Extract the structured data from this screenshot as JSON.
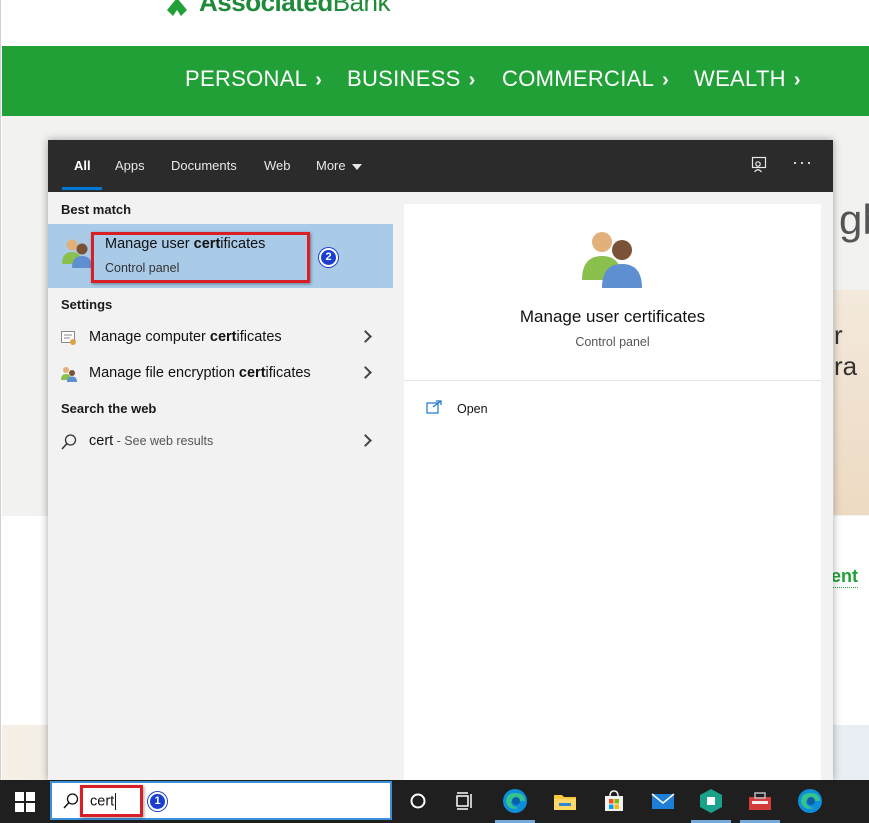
{
  "website": {
    "logo_text_bold": "Associated",
    "logo_text_light": "Bank",
    "nav": [
      "PERSONAL",
      "BUSINESS",
      "COMMERCIAL",
      "WEALTH"
    ],
    "nav_chevron": "›",
    "peek_text_1": "gh",
    "peek_text_2": "r ra",
    "peek_link": "ent",
    "brand_green": "#21a038"
  },
  "search_panel": {
    "tabs": [
      "All",
      "Apps",
      "Documents",
      "Web",
      "More"
    ],
    "active_tab": "All",
    "ellipsis": "···",
    "best_match_header": "Best match",
    "best_match": {
      "title_prefix": "Manage user ",
      "title_bold": "cert",
      "title_suffix": "ificates",
      "subtitle": "Control panel"
    },
    "settings_header": "Settings",
    "settings": [
      {
        "prefix": "Manage computer ",
        "bold": "cert",
        "suffix": "ificates",
        "icon": "certificate-icon"
      },
      {
        "prefix": "Manage file encryption ",
        "bold": "cert",
        "suffix": "ificates",
        "icon": "users-key-icon"
      }
    ],
    "web_header": "Search the web",
    "web_result": {
      "query": "cert",
      "suffix": " - See web results"
    },
    "detail": {
      "title": "Manage user certificates",
      "subtitle": "Control panel",
      "action": "Open"
    },
    "accent": "#0078d7",
    "highlight": "#a9cbe8"
  },
  "callouts": {
    "one": "1",
    "two": "2"
  },
  "taskbar": {
    "search_value": "cert",
    "icons": [
      "cortana-icon",
      "task-view-icon",
      "edge-icon",
      "file-explorer-icon",
      "store-icon",
      "mail-icon",
      "app-icon",
      "toolbox-icon",
      "edge-icon"
    ]
  }
}
